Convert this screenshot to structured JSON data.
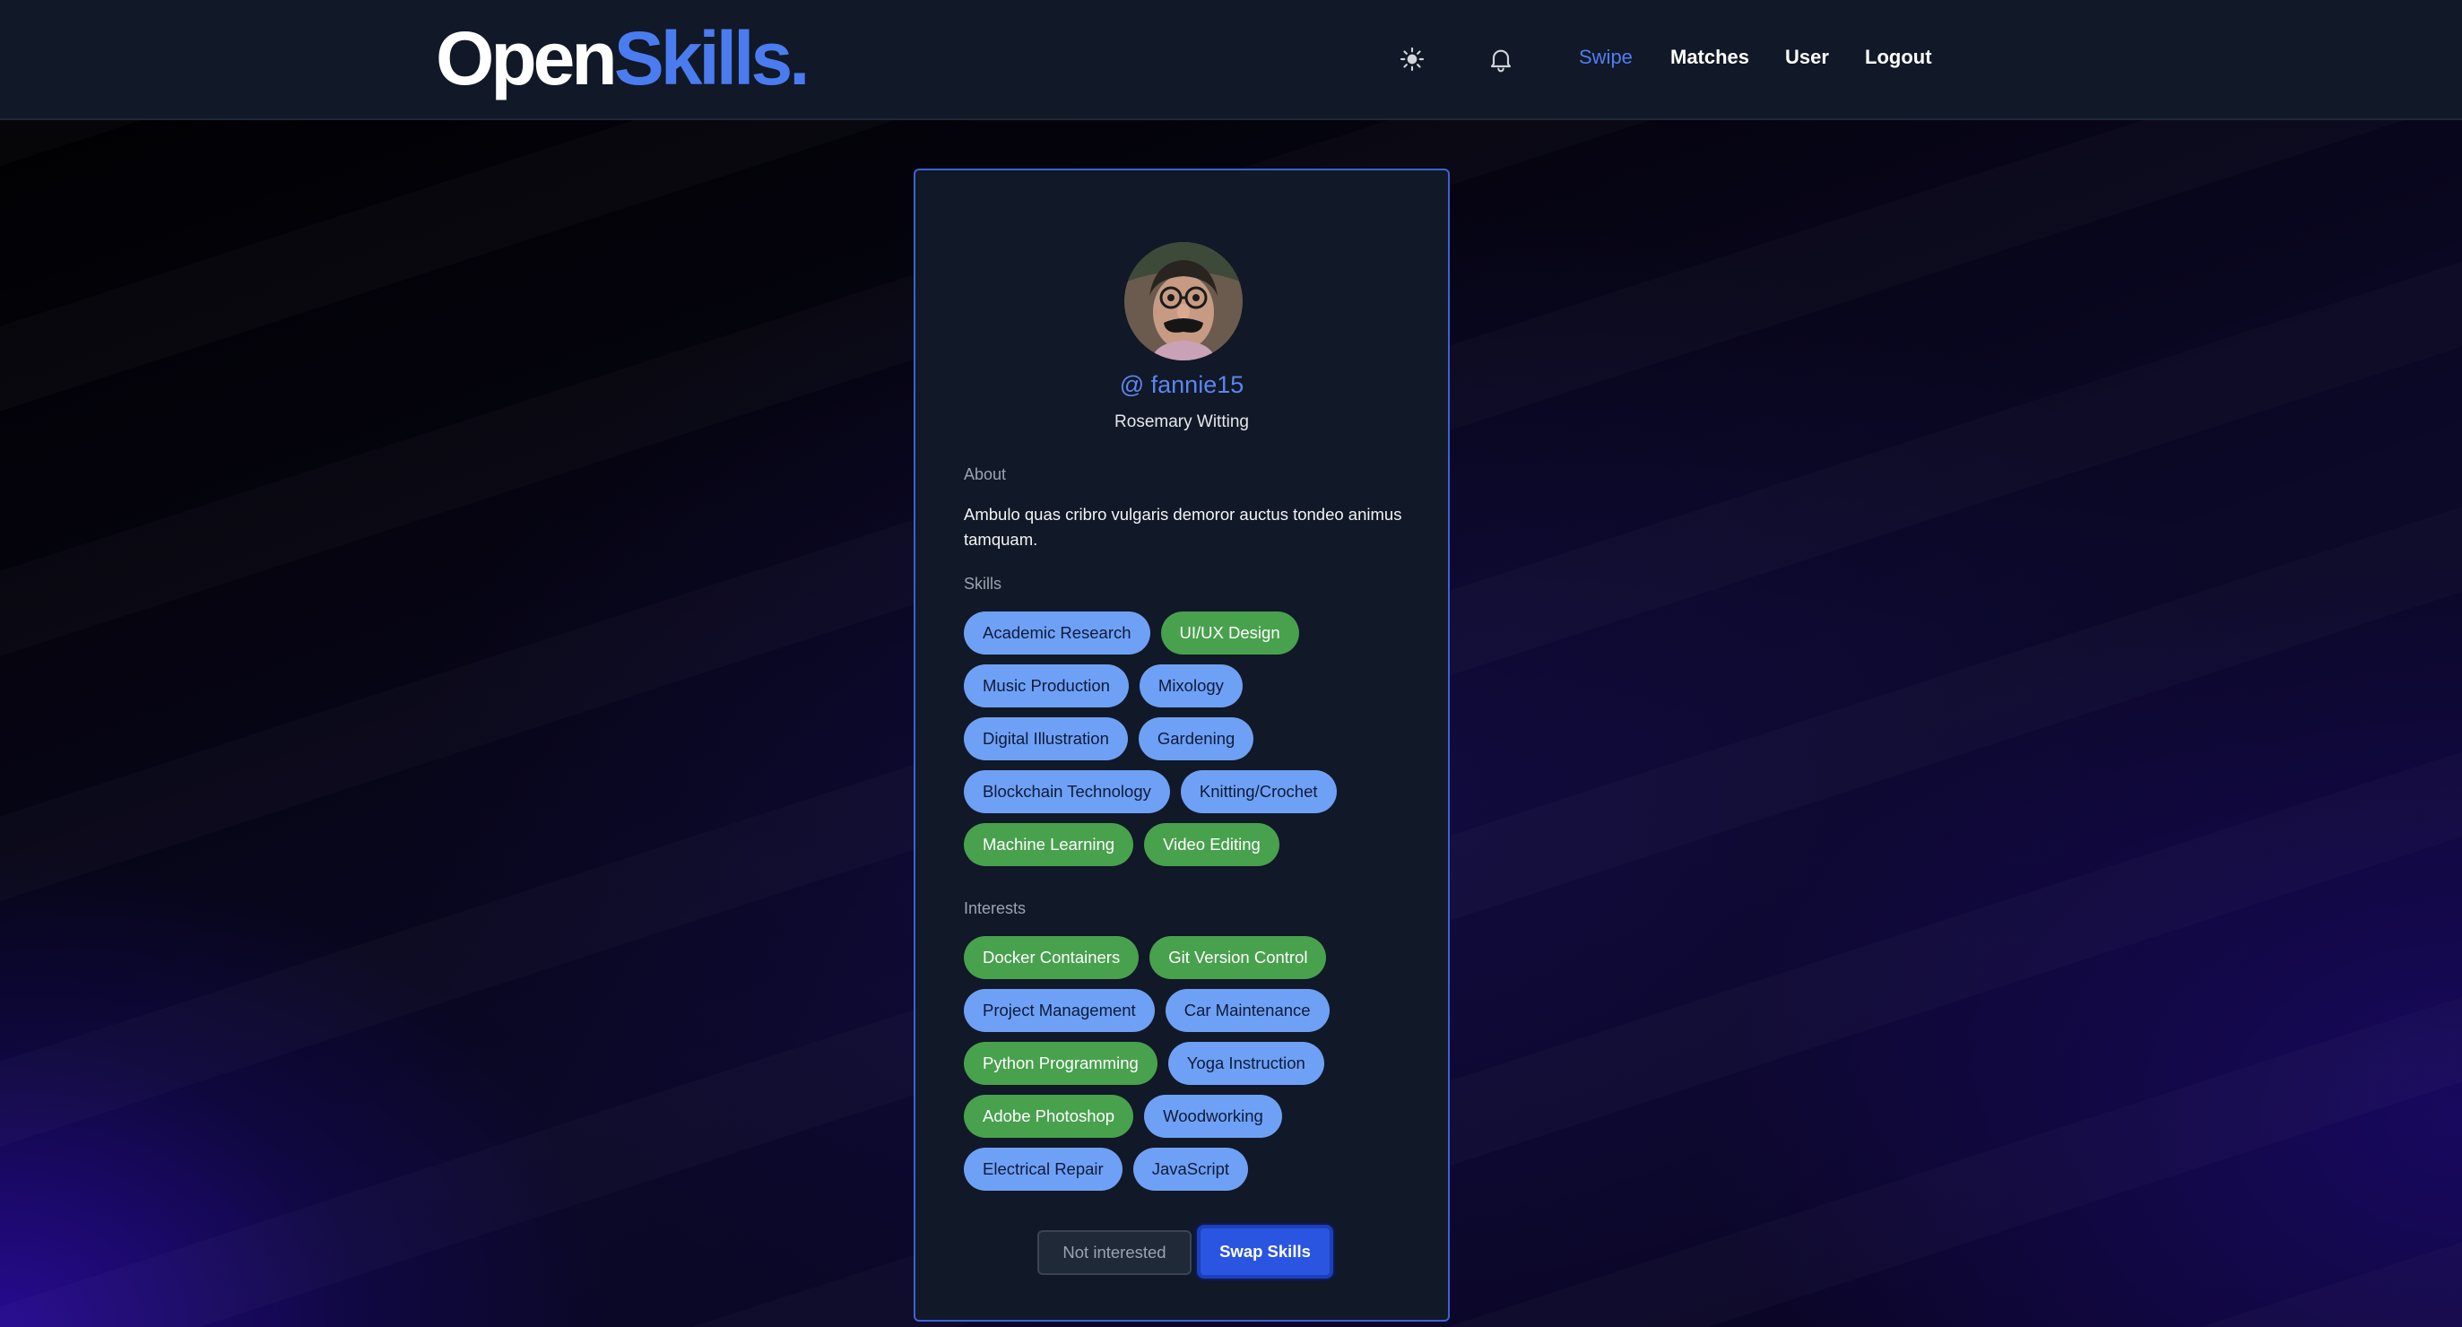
{
  "colors": {
    "accent": "#4f7df3",
    "header_bg": "#111827",
    "card_bg": "#111827",
    "card_border": "#3b63d6",
    "tag_blue": "#6ea1f5",
    "tag_green": "#48a14d",
    "swap_button": "#2a55e0"
  },
  "header": {
    "logo_part1": "Open",
    "logo_part2": "Skills.",
    "icons": {
      "theme": "sun-icon",
      "notifications": "bell-icon"
    },
    "nav": {
      "swipe": "Swipe",
      "matches": "Matches",
      "user": "User",
      "logout": "Logout"
    }
  },
  "profile": {
    "avatar_icon": "avatar-photo",
    "username": "@ fannie15",
    "full_name": "Rosemary Witting",
    "about_label": "About",
    "about_text": "Ambulo quas cribro vulgaris demoror auctus tondeo animus tamquam.",
    "skills_label": "Skills",
    "skills": [
      {
        "label": "Academic Research",
        "color": "blue"
      },
      {
        "label": "UI/UX Design",
        "color": "green"
      },
      {
        "label": "Music Production",
        "color": "blue"
      },
      {
        "label": "Mixology",
        "color": "blue"
      },
      {
        "label": "Digital Illustration",
        "color": "blue"
      },
      {
        "label": "Gardening",
        "color": "blue"
      },
      {
        "label": "Blockchain Technology",
        "color": "blue"
      },
      {
        "label": "Knitting/Crochet",
        "color": "blue"
      },
      {
        "label": "Machine Learning",
        "color": "green"
      },
      {
        "label": "Video Editing",
        "color": "green"
      }
    ],
    "interests_label": "Interests",
    "interests": [
      {
        "label": "Docker Containers",
        "color": "green"
      },
      {
        "label": "Git Version Control",
        "color": "green"
      },
      {
        "label": "Project Management",
        "color": "blue"
      },
      {
        "label": "Car Maintenance",
        "color": "blue"
      },
      {
        "label": "Python Programming",
        "color": "green"
      },
      {
        "label": "Yoga Instruction",
        "color": "blue"
      },
      {
        "label": "Adobe Photoshop",
        "color": "green"
      },
      {
        "label": "Woodworking",
        "color": "blue"
      },
      {
        "label": "Electrical Repair",
        "color": "blue"
      },
      {
        "label": "JavaScript",
        "color": "blue"
      }
    ]
  },
  "actions": {
    "not_interested": "Not interested",
    "swap_skills": "Swap Skills"
  }
}
